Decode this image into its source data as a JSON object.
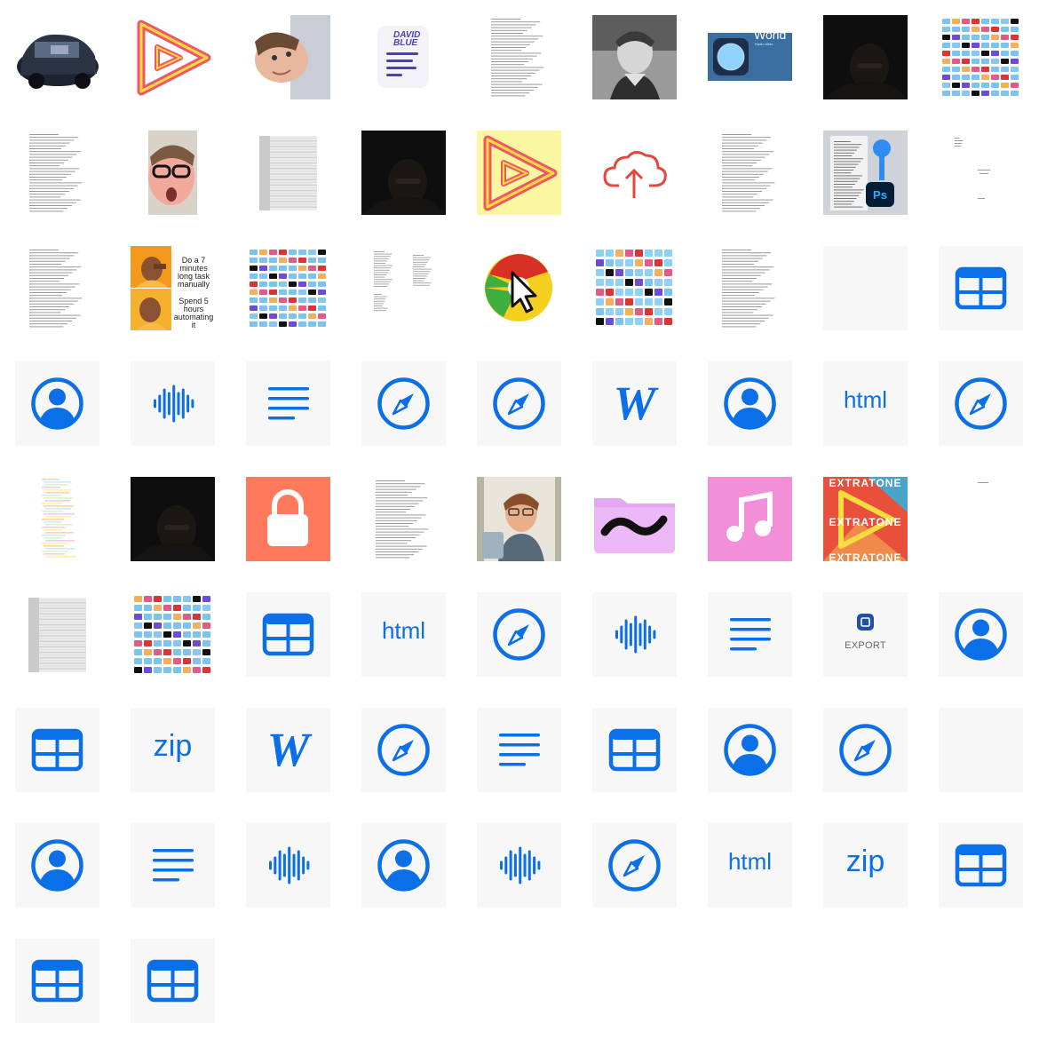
{
  "grid": {
    "rows": [
      [
        "photo-car",
        "play-logo",
        "photo-face-tilt",
        "david-blue-doc",
        "text-doc",
        "photo-bw-man",
        "world-app",
        "dark-photo",
        "icon-grid-colorful"
      ],
      [
        "text-doc",
        "photo-glasses-face",
        "spreadsheet",
        "dark-photo",
        "play-logo-yellow",
        "cloud-upload",
        "text-doc",
        "photoshop-key",
        "sparse-doc"
      ],
      [
        "text-doc",
        "drake-meme",
        "icon-grid-colorful",
        "text-doc-two-col",
        "chrome-cursor",
        "folder-grid",
        "text-doc",
        "blank",
        "table-icon"
      ],
      [
        "contact-icon",
        "audio-icon",
        "text-icon",
        "safari-icon",
        "safari-icon",
        "word-icon",
        "contact-icon",
        "html-icon",
        "safari-icon"
      ],
      [
        "text-doc-colored",
        "dark-photo",
        "lock-app",
        "text-doc",
        "photo-man-mug",
        "tilde-folder",
        "music-app",
        "extratone-art",
        "tiny-text"
      ],
      [
        "spreadsheet",
        "icon-grid-small",
        "table-icon",
        "html-icon",
        "safari-icon",
        "audio-icon",
        "text-icon",
        "export-icon",
        "contact-icon"
      ],
      [
        "table-icon",
        "zip-icon",
        "word-icon",
        "safari-icon",
        "text-icon",
        "table-icon",
        "contact-icon",
        "safari-icon",
        "blank-icon"
      ],
      [
        "contact-icon",
        "text-icon",
        "audio-icon",
        "contact-icon",
        "audio-icon",
        "safari-icon",
        "html-icon",
        "zip-icon",
        "table-icon"
      ],
      [
        "table-icon",
        "table-icon"
      ]
    ]
  },
  "labels": {
    "html": "html",
    "zip": "zip",
    "word": "W",
    "export": "EXPORT",
    "meme_top": "Do a 7 minutes long task manually",
    "meme_bottom": "Spend 5 hours automating it",
    "world": "World",
    "world_sub": "Radio Atlas",
    "david": "DAVID BLUE",
    "extratone": "EXTRATONE",
    "ps": "Ps"
  },
  "colors": {
    "icon_blue": "#0b6fe8",
    "icon_tile_bg": "#f7f7f7",
    "lock_orange": "#ff7a5c",
    "music_pink": "#f38fd8",
    "folder_purple": "#e6a6f2",
    "play_red": "#f0566a",
    "play_yellow": "#f7dc3e"
  }
}
